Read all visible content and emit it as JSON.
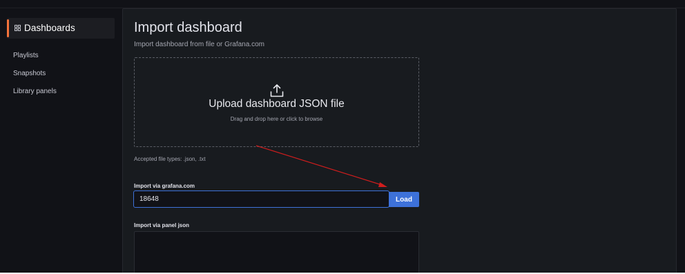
{
  "sidebar": {
    "active": {
      "label": "Dashboards",
      "icon": "apps-grid-icon",
      "accent": "#f5733b"
    },
    "items": [
      {
        "label": "Playlists"
      },
      {
        "label": "Snapshots"
      },
      {
        "label": "Library panels"
      }
    ]
  },
  "page": {
    "title": "Import dashboard",
    "subtitle": "Import dashboard from file or Grafana.com"
  },
  "upload": {
    "icon": "upload-icon",
    "title": "Upload dashboard JSON file",
    "hint": "Drag and drop here or click to browse",
    "accepted": "Accepted file types: .json, .txt"
  },
  "grafana_com": {
    "label": "Import via grafana.com",
    "value": "18648",
    "button_label": "Load"
  },
  "panel_json": {
    "label": "Import via panel json",
    "value": ""
  },
  "annotation": {
    "arrow_color": "#d01d1d"
  },
  "colors": {
    "primary": "#3d71d9",
    "background": "#111217",
    "panel": "#181b1f"
  }
}
